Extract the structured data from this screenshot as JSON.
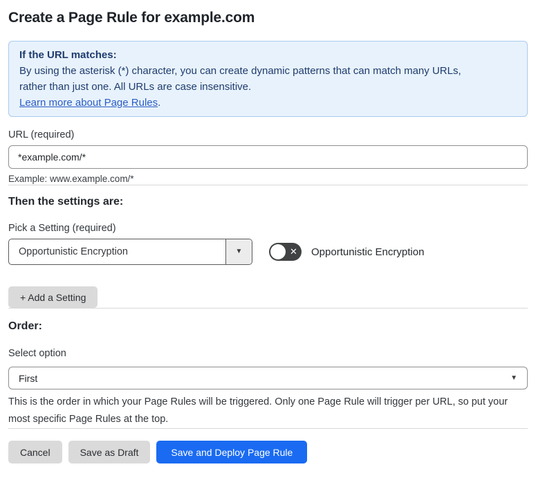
{
  "page": {
    "title": "Create a Page Rule for example.com"
  },
  "info_box": {
    "heading": "If the URL matches:",
    "body_line1": "By using the asterisk (*) character, you can create dynamic patterns that can match many URLs,",
    "body_line2": "rather than just one. All URLs are case insensitive.",
    "link_text": "Learn more about Page Rules",
    "link_suffix": "."
  },
  "url_field": {
    "label": "URL (required)",
    "value": "*example.com/*",
    "helper": "Example: www.example.com/*"
  },
  "settings_section": {
    "heading": "Then the settings are:",
    "picker_label": "Pick a Setting (required)",
    "picker_value": "Opportunistic Encryption",
    "toggle_state": "off",
    "toggle_label": "Opportunistic Encryption",
    "add_button_label": "+ Add a Setting"
  },
  "order_section": {
    "heading": "Order:",
    "select_label": "Select option",
    "select_value": "First",
    "helper_line1": "This is the order in which your Page Rules will be triggered. Only one Page Rule will trigger per URL, so put your",
    "helper_line2": "most specific Page Rules at the top."
  },
  "footer": {
    "cancel_label": "Cancel",
    "save_draft_label": "Save as Draft",
    "save_deploy_label": "Save and Deploy Page Rule"
  },
  "icons": {
    "dropdown_caret": "▼",
    "select_caret": "▼",
    "toggle_off_x": "✕"
  },
  "colors": {
    "accent_blue": "#1a6bf2",
    "info_box_bg": "#e8f2fc",
    "info_box_border": "#a9c9ee",
    "info_box_text": "#1e3c6e",
    "link_blue": "#2b5dc4",
    "toggle_off_bg": "#404244",
    "gray_button_bg": "#dadada"
  }
}
